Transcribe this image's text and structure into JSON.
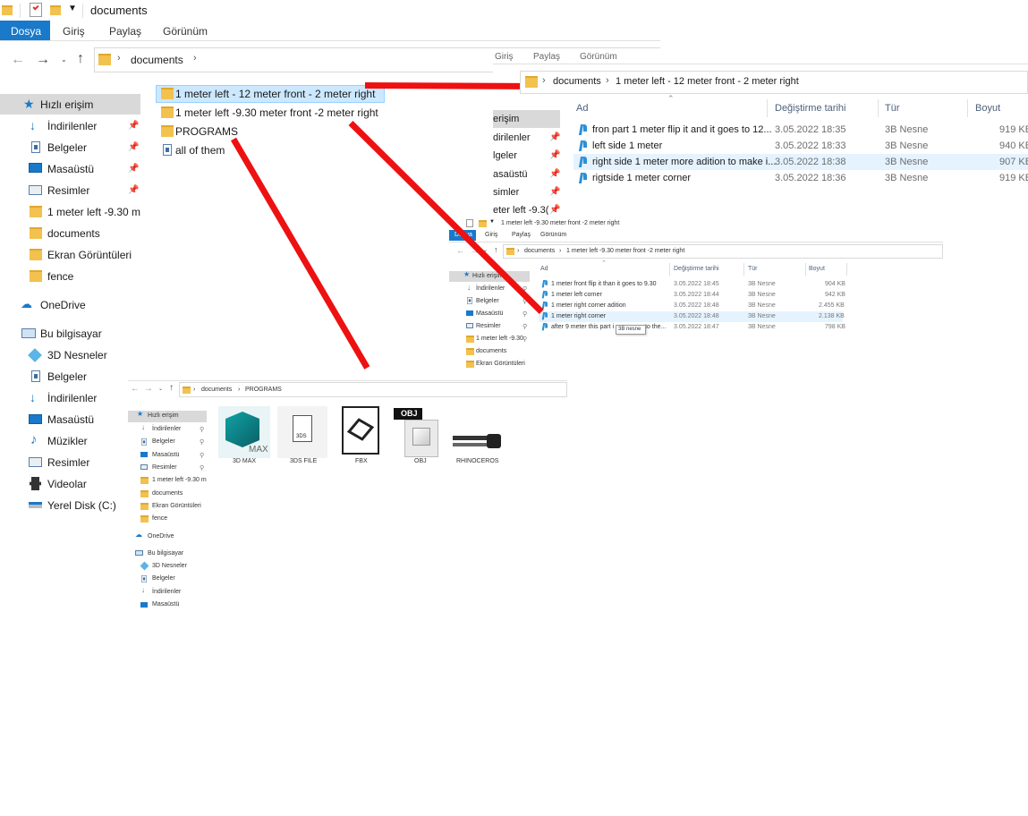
{
  "main": {
    "title": "documents",
    "ribbon_tabs": [
      "Dosya",
      "Giriş",
      "Paylaş",
      "Görünüm"
    ],
    "address": [
      "documents"
    ],
    "sidebar": [
      {
        "label": "Hızlı erişim"
      },
      {
        "label": "İndirilenler"
      },
      {
        "label": "Belgeler"
      },
      {
        "label": "Masaüstü"
      },
      {
        "label": "Resimler"
      },
      {
        "label": "1 meter left -9.30 m"
      },
      {
        "label": "documents"
      },
      {
        "label": "Ekran Görüntüleri"
      },
      {
        "label": "fence"
      },
      {
        "label": "OneDrive"
      },
      {
        "label": "Bu bilgisayar"
      },
      {
        "label": "3D Nesneler"
      },
      {
        "label": "Belgeler"
      },
      {
        "label": "İndirilenler"
      },
      {
        "label": "Masaüstü"
      },
      {
        "label": "Müzikler"
      },
      {
        "label": "Resimler"
      },
      {
        "label": "Videolar"
      },
      {
        "label": "Yerel Disk (C:)"
      }
    ],
    "items": [
      "1 meter left - 12 meter front - 2 meter right",
      "1 meter left -9.30 meter front -2 meter right",
      "PROGRAMS",
      "all of them"
    ]
  },
  "win1": {
    "tabs_partial": [
      "Giriş",
      "Paylaş",
      "Görünüm"
    ],
    "address": [
      "documents",
      "1 meter left - 12 meter front - 2 meter right"
    ],
    "sidebar": [
      "erişim",
      "dirilenler",
      "lgeler",
      "asaüstü",
      "simler",
      "eter left -9.3("
    ],
    "columns": [
      "Ad",
      "Değiştirme tarihi",
      "Tür",
      "Boyut"
    ],
    "rows": [
      {
        "name": "fron part  1 meter flip it and it  goes to 12...",
        "date": "3.05.2022 18:35",
        "type": "3B Nesne",
        "size": "919 KB"
      },
      {
        "name": "left  side 1 meter",
        "date": "3.05.2022 18:33",
        "type": "3B Nesne",
        "size": "940 KB"
      },
      {
        "name": "right side 1 meter more adition to make i...",
        "date": "3.05.2022 18:38",
        "type": "3B Nesne",
        "size": "907 KB"
      },
      {
        "name": "rigtside 1 meter corner",
        "date": "3.05.2022 18:36",
        "type": "3B Nesne",
        "size": "919 KB"
      }
    ]
  },
  "win2": {
    "title": "1 meter left -9.30 meter front -2 meter right",
    "tabs": [
      "Dosya",
      "Giriş",
      "Paylaş",
      "Görünüm"
    ],
    "address": [
      "documents",
      "1 meter left -9.30 meter front -2 meter right"
    ],
    "sidebar": [
      "Hızlı erişim",
      "İndirilenler",
      "Belgeler",
      "Masaüstü",
      "Resimler",
      "1 meter left -9.30",
      "documents",
      "Ekran Görüntüleri"
    ],
    "columns": [
      "Ad",
      "Değiştirme tarihi",
      "Tür",
      "Boyut"
    ],
    "rows": [
      {
        "name": "1 meter front flip it than  it goes to 9.30",
        "date": "3.05.2022 18:45",
        "type": "3B Nesne",
        "size": "904 KB"
      },
      {
        "name": "1 meter left corner",
        "date": "3.05.2022 18:44",
        "type": "3B Nesne",
        "size": "942 KB"
      },
      {
        "name": "1 meter right corner adition",
        "date": "3.05.2022 18:48",
        "type": "3B Nesne",
        "size": "2.455 KB"
      },
      {
        "name": "1 meter right corner",
        "date": "3.05.2022 18:48",
        "type": "3B Nesne",
        "size": "2.138 KB"
      },
      {
        "name": "after 9 meter  this part i",
        "name_tail": "to the...",
        "date": "3.05.2022 18:47",
        "type": "3B Nesne",
        "size": "798 KB"
      }
    ],
    "tooltip": "3B nesne"
  },
  "win3": {
    "address": [
      "documents",
      "PROGRAMS"
    ],
    "sidebar": [
      "Hızlı erişim",
      "İndirilenler",
      "Belgeler",
      "Masaüstü",
      "Resimler",
      "1 meter left -9.30 m",
      "documents",
      "Ekran Görüntüleri",
      "fence",
      "OneDrive",
      "Bu bilgisayar",
      "3D Nesneler",
      "Belgeler",
      "İndirilenler",
      "Masaüstü"
    ],
    "programs": [
      {
        "label": "3D MAX",
        "logo_text": "MAX"
      },
      {
        "label": "3DS FILE",
        "logo_text": "3DS"
      },
      {
        "label": "FBX",
        "logo_text": ""
      },
      {
        "label": "OBJ",
        "logo_text": "OBJ"
      },
      {
        "label": "RHINOCEROS",
        "logo_text": ""
      }
    ]
  },
  "colors": {
    "accent": "#1979ca",
    "selection": "#cce8ff",
    "annotation_red": "#ee1111",
    "folder": "#f2c14e"
  }
}
